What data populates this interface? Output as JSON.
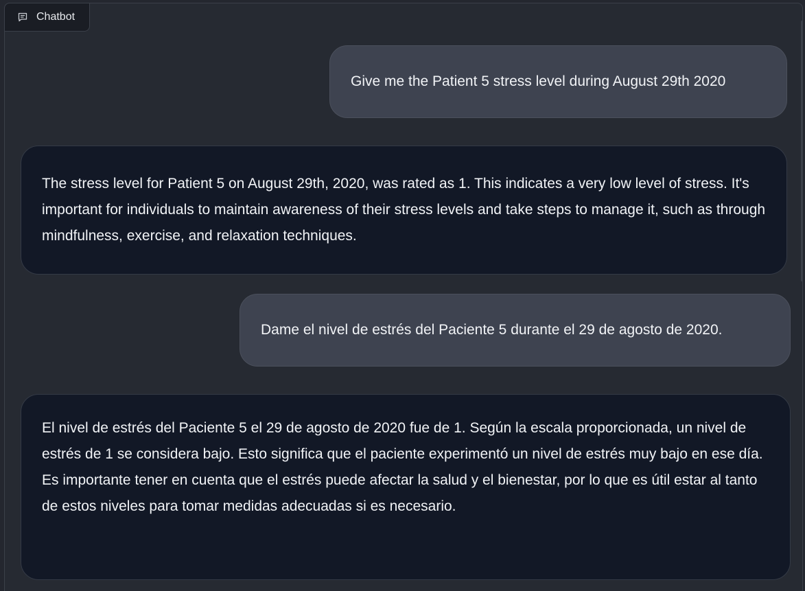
{
  "panel": {
    "label": "Chatbot",
    "icon": "chat-icon"
  },
  "messages": [
    {
      "role": "user",
      "text": "Give me the Patient 5 stress level during August 29th 2020"
    },
    {
      "role": "bot",
      "text": "The stress level for Patient 5 on August 29th, 2020, was rated as 1. This indicates a very low level of stress. It's important for individuals to maintain awareness of their stress levels and take steps to manage it, such as through mindfulness, exercise, and relaxation techniques."
    },
    {
      "role": "user",
      "text": "Dame el nivel de estrés del Paciente 5 durante el 29 de agosto de 2020."
    },
    {
      "role": "bot",
      "text": "El nivel de estrés del Paciente 5 el 29 de agosto de 2020 fue de 1. Según la escala proporcionada, un nivel de estrés de 1 se considera bajo. Esto significa que el paciente experimentó un nivel de estrés muy bajo en ese día. Es importante tener en cuenta que el estrés puede afectar la salud y el bienestar, por lo que es útil estar al tanto de estos niveles para tomar medidas adecuadas si es necesario."
    }
  ]
}
